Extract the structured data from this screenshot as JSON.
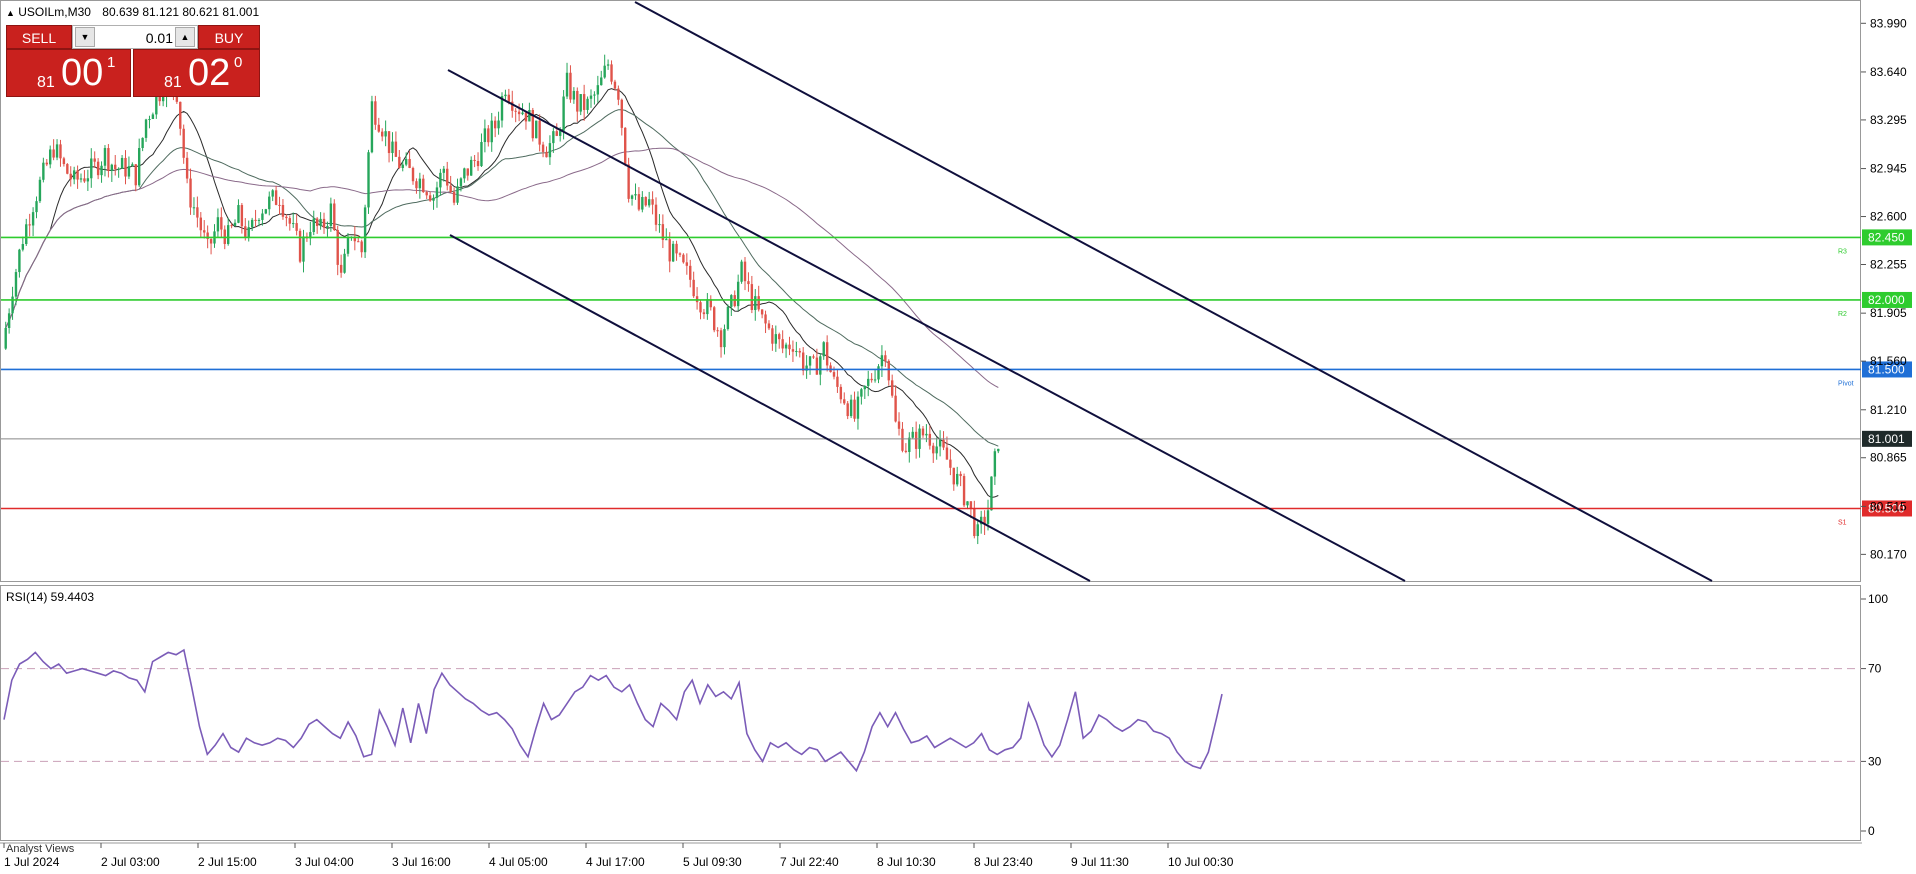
{
  "window": {
    "symbol_line": "USOILm,M30",
    "ohlc": "80.639 81.121 80.621 81.001"
  },
  "trade_panel": {
    "sell_label": "SELL",
    "buy_label": "BUY",
    "lot_value": "0.01",
    "sell_price_small": "81",
    "sell_price_big": "00",
    "sell_price_sup": "1",
    "buy_price_small": "81",
    "buy_price_big": "02",
    "buy_price_sup": "0"
  },
  "price_axis": {
    "ticks": [
      "83.990",
      "83.640",
      "83.295",
      "82.945",
      "82.600",
      "82.255",
      "81.905",
      "81.560",
      "81.210",
      "80.865",
      "80.515",
      "80.170"
    ],
    "range": [
      80.0,
      84.1
    ]
  },
  "levels": [
    {
      "name": "R3",
      "price": 82.45,
      "label": "82.450",
      "color": "#2ecc2e"
    },
    {
      "name": "R2",
      "price": 82.0,
      "label": "82.000",
      "color": "#2ecc2e"
    },
    {
      "name": "Pivot",
      "price": 81.5,
      "label": "81.500",
      "color": "#1f6fd6"
    },
    {
      "name": "S1",
      "price": 80.5,
      "label": "80.500",
      "color": "#e02b2b"
    }
  ],
  "current_price": {
    "label": "81.001",
    "value": 81.001
  },
  "rsi": {
    "label": "RSI(14) 59.4403",
    "ticks": [
      "100",
      "70",
      "30",
      "0"
    ],
    "levels": [
      70,
      30
    ],
    "values": [
      48,
      65,
      72,
      74,
      77,
      73,
      70,
      72,
      68,
      69,
      70,
      69,
      68,
      67,
      69,
      68,
      66,
      65,
      60,
      73,
      75,
      77,
      76,
      78,
      62,
      45,
      33,
      37,
      42,
      36,
      34,
      40,
      38,
      37,
      38,
      40,
      39,
      36,
      40,
      46,
      48,
      45,
      42,
      40,
      47,
      41,
      32,
      33,
      52,
      45,
      37,
      53,
      38,
      55,
      42,
      61,
      68,
      63,
      60,
      57,
      55,
      52,
      50,
      51,
      48,
      44,
      37,
      32,
      44,
      55,
      48,
      50,
      55,
      60,
      62,
      67,
      65,
      67,
      62,
      60,
      63,
      55,
      48,
      45,
      55,
      52,
      48,
      60,
      65,
      55,
      63,
      58,
      60,
      57,
      64,
      42,
      35,
      30,
      38,
      36,
      38,
      35,
      33,
      36,
      35,
      30,
      32,
      34,
      30,
      26,
      34,
      45,
      51,
      45,
      51,
      44,
      38,
      39,
      41,
      36,
      38,
      40,
      38,
      36,
      38,
      42,
      35,
      33,
      35,
      36,
      40,
      55,
      47,
      37,
      32,
      37,
      48,
      60,
      40,
      43,
      50,
      48,
      45,
      43,
      45,
      48,
      47,
      43,
      42,
      40,
      34,
      30,
      28,
      27,
      34,
      48,
      59
    ]
  },
  "time_axis": {
    "labels": [
      "1 Jul 2024",
      "2 Jul 03:00",
      "2 Jul 15:00",
      "3 Jul 04:00",
      "3 Jul 16:00",
      "4 Jul 05:00",
      "4 Jul 17:00",
      "5 Jul 09:30",
      "7 Jul 22:40",
      "8 Jul 10:30",
      "8 Jul 23:40",
      "9 Jul 11:30",
      "10 Jul 00:30"
    ]
  },
  "footer": {
    "analyst_views": "Analyst Views"
  },
  "colors": {
    "bull": "#26a65b",
    "bear": "#e0534a",
    "trend": "#0f0f3c",
    "rsi": "#7b5cb8",
    "ma_fast": "#2a2a2a",
    "ma_mid": "#4f6b5f",
    "ma_slow": "#8a6a8a"
  },
  "chart_data": {
    "type": "candlestick",
    "symbol": "USOILm",
    "timeframe": "M30",
    "price_range": [
      80.0,
      84.1
    ],
    "close_path": [
      81.65,
      82.1,
      82.45,
      82.7,
      82.9,
      83.1,
      82.95,
      82.85,
      82.9,
      82.95,
      83.05,
      82.95,
      82.95,
      82.9,
      83.3,
      83.45,
      83.6,
      83.5,
      82.8,
      82.6,
      82.35,
      82.55,
      82.45,
      82.6,
      82.45,
      82.65,
      82.7,
      82.75,
      82.55,
      82.35,
      82.55,
      82.5,
      82.65,
      82.15,
      82.5,
      82.35,
      83.4,
      83.25,
      83.05,
      82.95,
      82.9,
      82.85,
      82.75,
      82.95,
      82.7,
      82.9,
      83.0,
      83.15,
      83.25,
      83.55,
      83.4,
      83.35,
      83.2,
      83.1,
      83.15,
      83.55,
      83.4,
      83.4,
      83.5,
      83.7,
      83.5,
      82.8,
      82.65,
      82.7,
      82.5,
      82.35,
      82.25,
      82.15,
      82.0,
      81.9,
      81.75,
      81.95,
      82.2,
      82.0,
      81.85,
      81.75,
      81.65,
      81.7,
      81.55,
      81.5,
      81.65,
      81.4,
      81.3,
      81.15,
      81.35,
      81.5,
      81.65,
      81.1,
      80.95,
      81.0,
      81.05,
      80.95,
      80.85,
      80.7,
      80.55,
      80.3,
      80.5,
      81.0
    ]
  }
}
